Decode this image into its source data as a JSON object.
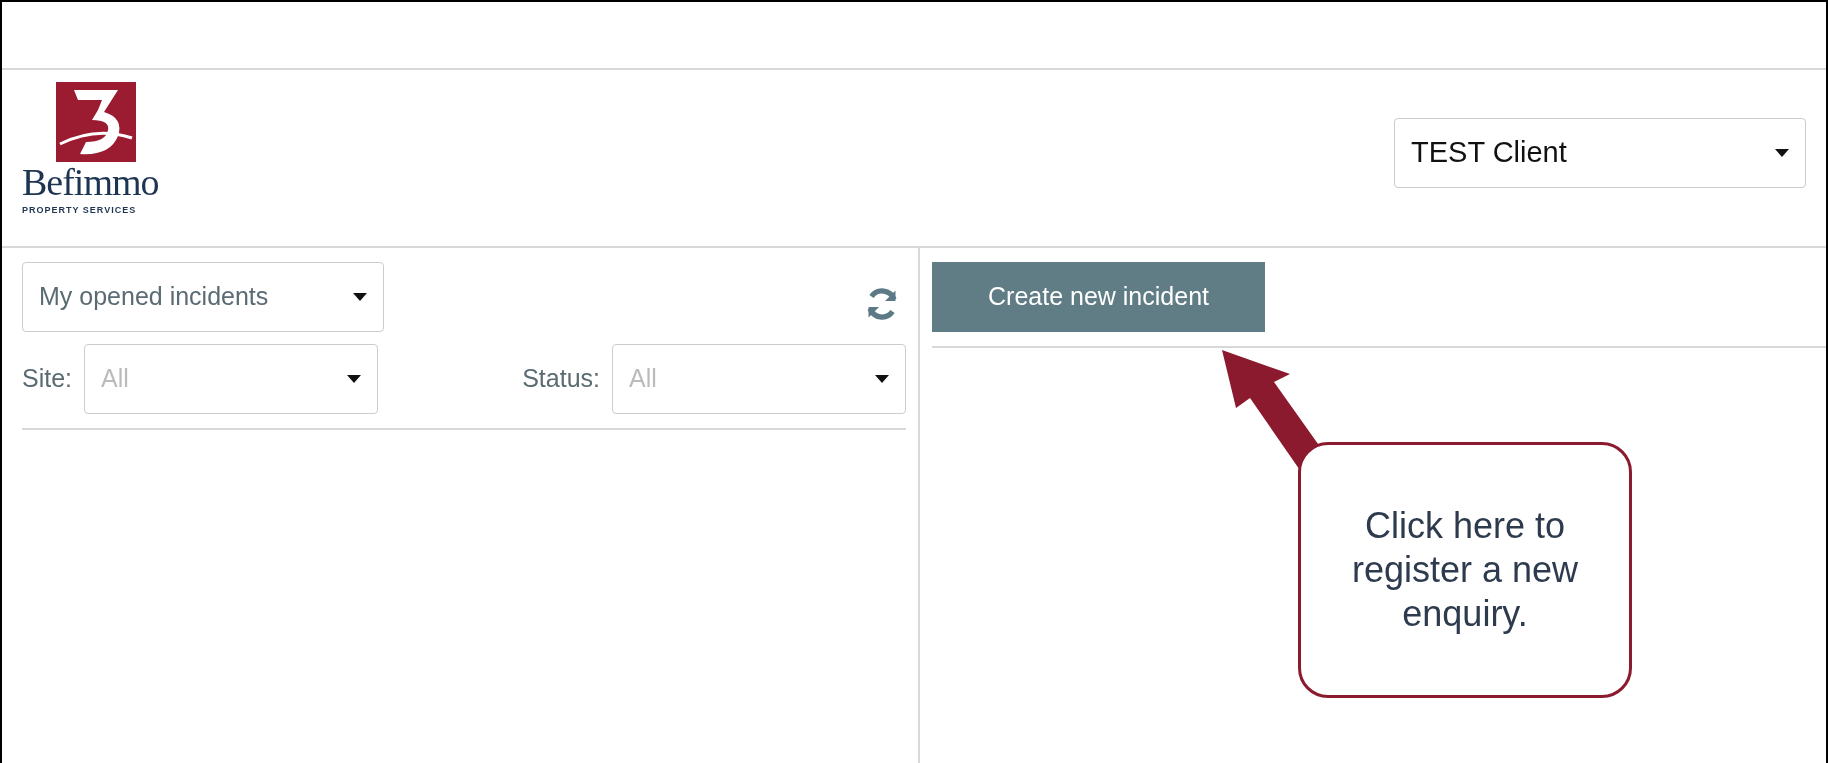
{
  "header": {
    "logo": {
      "name": "Befimmo",
      "tagline": "PROPERTY SERVICES"
    },
    "client_select": {
      "value": "TEST Client"
    }
  },
  "incident_list": {
    "filter_select": {
      "value": "My opened incidents"
    },
    "site": {
      "label": "Site:",
      "placeholder": "All"
    },
    "status": {
      "label": "Status:",
      "placeholder": "All"
    }
  },
  "detail": {
    "create_button": "Create new incident"
  },
  "annotation": {
    "text": "Click here to register a new enquiry."
  }
}
